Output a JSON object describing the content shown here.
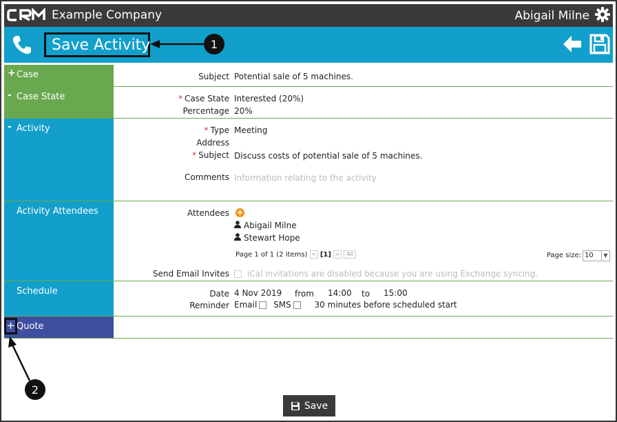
{
  "topbar": {
    "company": "Example Company",
    "user": "Abigail Milne"
  },
  "header": {
    "title": "Save Activity"
  },
  "callouts": {
    "one": "1",
    "two": "2"
  },
  "sections": {
    "case": {
      "sign": "+",
      "name": "Case",
      "subject_label": "Subject",
      "subject_value": "Potential sale of 5 machines."
    },
    "case_state": {
      "sign": "-",
      "name": "Case State",
      "state_label": "Case State",
      "state_value": "Interested (20%)",
      "pct_label": "Percentage",
      "pct_value": "20%"
    },
    "activity": {
      "sign": "-",
      "name": "Activity",
      "type_label": "Type",
      "type_value": "Meeting",
      "address_label": "Address",
      "subject_label": "Subject",
      "subject_value": "Discuss costs of potential sale of 5 machines.",
      "comments_label": "Comments",
      "comments_placeholder": "Information relating to the activity"
    },
    "attendees": {
      "name": "Activity Attendees",
      "attendees_label": "Attendees",
      "people": [
        "Abigail Milne",
        "Stewart Hope"
      ],
      "pager_text": "Page 1 of 1 (2 items)",
      "pager_current": "[1]",
      "pager_all": "All",
      "page_size_label": "Page size:",
      "page_size_value": "10",
      "invites_label": "Send Email Invites",
      "invites_note": "iCal invitations are disabled because you are using Exchange syncing."
    },
    "schedule": {
      "name": "Schedule",
      "date_label": "Date",
      "date_value": "4 Nov 2019",
      "from_label": "from",
      "from_value": "14:00",
      "to_label": "to",
      "to_value": "15:00",
      "reminder_label": "Reminder",
      "email_label": "Email",
      "sms_label": "SMS",
      "minutes_value": "30 minutes",
      "before_text": "before scheduled start"
    },
    "quote": {
      "sign": "+",
      "name": "Quote"
    }
  },
  "footer": {
    "save_label": "Save"
  },
  "colors": {
    "green": "#6aa84f",
    "blue": "#129fcb",
    "purple": "#3f4fa0",
    "topbar": "#3a3a3a"
  }
}
